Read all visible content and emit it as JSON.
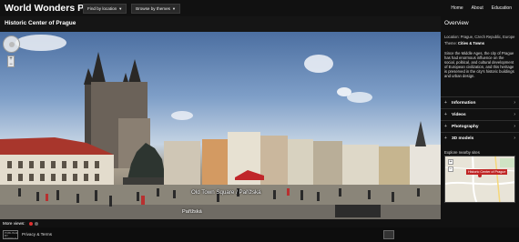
{
  "app": {
    "brand": "World Wonders Project",
    "dropdowns": [
      "Find by location",
      "Browse by themes"
    ],
    "nav": [
      "Home",
      "About",
      "Education"
    ]
  },
  "place": {
    "title": "Historic Center of Prague",
    "street_label": "Old Town Square / Pařížská",
    "street_label_2": "Pařížská"
  },
  "more_views": {
    "label": "More views:",
    "count": 2,
    "active_index": 0
  },
  "footer": {
    "links": "Privacy & Terms",
    "logo_text": "PUBLISHED BY GOOGLE CULTURAL INSTITUTE"
  },
  "overview": {
    "title": "Overview",
    "location_label": "Location:",
    "location_value": "Prague, Czech Republic, Europe",
    "theme_label": "Theme:",
    "theme_value": "Cities & Towns",
    "description": "Since the Middle Ages, the city of Prague has had enormous influence on the social, political, and cultural development of European civilization, and this heritage is preserved in the city's historic buildings and urban design.",
    "sections": [
      {
        "label": "Information",
        "expander": "+"
      },
      {
        "label": "Videos",
        "expander": "+"
      },
      {
        "label": "Photography",
        "expander": "+"
      },
      {
        "label": "3D models",
        "expander": "+"
      }
    ],
    "explore_label": "Explore nearby sites",
    "map_pin_label": "Historic Center of Prague",
    "zoom_in": "+",
    "zoom_out": "−"
  },
  "colors": {
    "accent_red": "#c02525",
    "bar_bg": "#111111"
  }
}
